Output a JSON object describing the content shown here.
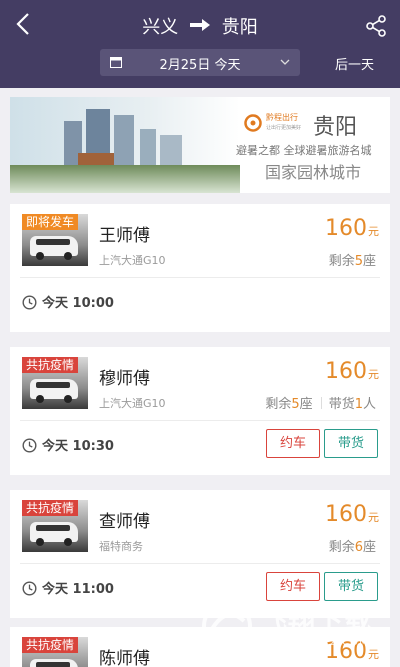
{
  "header": {
    "origin": "兴义",
    "destination": "贵阳",
    "date_label": "2月25日 今天",
    "next_day_label": "后一天"
  },
  "banner": {
    "brand_name": "黔程出行",
    "brand_sub": "让出行更加美好",
    "city": "贵阳",
    "slogan1": "避暑之都 全球避暑旅游名城",
    "slogan2": "国家园林城市"
  },
  "trips": [
    {
      "tag": "即将发车",
      "tag_color": "#f08a24",
      "driver": "王师傅",
      "model": "上汽大通G10",
      "price": "160",
      "price_unit": "元",
      "seats_prefix": "剩余",
      "seats": "5",
      "seats_suffix": "座",
      "cargo_prefix": "",
      "cargo": "",
      "cargo_suffix": "",
      "time": "今天 10:00",
      "has_buttons": false
    },
    {
      "tag": "共抗疫情",
      "tag_color": "#d9443c",
      "driver": "穆师傅",
      "model": "上汽大通G10",
      "price": "160",
      "price_unit": "元",
      "seats_prefix": "剩余",
      "seats": "5",
      "seats_suffix": "座",
      "cargo_prefix": "带货",
      "cargo": "1",
      "cargo_suffix": "人",
      "time": "今天 10:30",
      "has_buttons": true
    },
    {
      "tag": "共抗疫情",
      "tag_color": "#d9443c",
      "driver": "查师傅",
      "model": "福特商务",
      "price": "160",
      "price_unit": "元",
      "seats_prefix": "剩余",
      "seats": "6",
      "seats_suffix": "座",
      "cargo_prefix": "",
      "cargo": "",
      "cargo_suffix": "",
      "time": "今天 11:00",
      "has_buttons": true
    },
    {
      "tag": "共抗疫情",
      "tag_color": "#d9443c",
      "driver": "陈师傅",
      "model": "",
      "price": "160",
      "price_unit": "元",
      "seats_prefix": "",
      "seats": "",
      "seats_suffix": "",
      "cargo_prefix": "",
      "cargo": "",
      "cargo_suffix": "",
      "time": "",
      "has_buttons": false
    }
  ],
  "buttons": {
    "book": "约车",
    "cargo": "带货"
  },
  "watermark": {
    "title": "飞翔下载",
    "url": "WWW.FXXZ.COM"
  }
}
